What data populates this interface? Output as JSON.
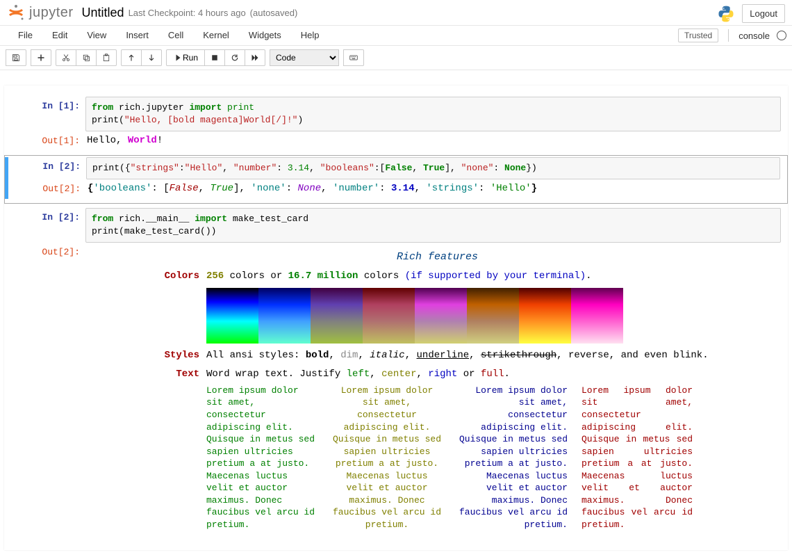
{
  "header": {
    "logo_text": "jupyter",
    "title": "Untitled",
    "checkpoint": "Last Checkpoint: 4 hours ago",
    "autosave": "(autosaved)",
    "logout": "Logout"
  },
  "menu": {
    "file": "File",
    "edit": "Edit",
    "view": "View",
    "insert": "Insert",
    "cell": "Cell",
    "kernel": "Kernel",
    "widgets": "Widgets",
    "help": "Help",
    "trusted": "Trusted",
    "console": "console"
  },
  "toolbar": {
    "run": "Run",
    "celltype": "Code"
  },
  "cells": [
    {
      "in_prompt": "In [1]:",
      "out_prompt": "Out[1]:",
      "code": {
        "l1": {
          "kw_from": "from",
          "mod": " rich.jupyter ",
          "kw_import": "import",
          "what": " print"
        },
        "l2": {
          "fn": "print",
          "paren_open": "(",
          "str": "\"Hello, [bold magenta]World[/]!\"",
          "paren_close": ")"
        }
      },
      "out": {
        "hello": "Hello, ",
        "world": "World",
        "bang": "!"
      }
    },
    {
      "in_prompt": "In [2]:",
      "out_prompt": "Out[2]:",
      "code": {
        "fn": "print",
        "paren_open": "({",
        "k_strings": "\"strings\"",
        "c1": ":",
        "v_strings": "\"Hello\"",
        "comma1": ", ",
        "k_number": "\"number\"",
        "c2": ": ",
        "v_number": "3.14",
        "comma2": ", ",
        "k_bool": "\"booleans\"",
        "c3": ":[",
        "v_false": "False",
        "comma3": ", ",
        "v_true": "True",
        "close_b": "], ",
        "k_none": "\"none\"",
        "c4": ": ",
        "v_none": "None",
        "paren_close": "})"
      },
      "out": {
        "open": "{",
        "k1": "'booleans'",
        "c1": ": [",
        "v_false": "False",
        "comma": ", ",
        "v_true": "True",
        "close1": "], ",
        "k2": "'none'",
        "c2": ": ",
        "v_none": "None",
        "comma2": ", ",
        "k3": "'number'",
        "c3": ": ",
        "v_num": "3.14",
        "comma3": ", ",
        "k4": "'strings'",
        "c4": ": ",
        "v_str": "'Hello'",
        "close": "}"
      }
    },
    {
      "in_prompt": "In [2]:",
      "out_prompt": "Out[2]:",
      "code": {
        "l1": {
          "kw_from": "from",
          "mod": " rich.__main__ ",
          "kw_import": "import",
          "what": " make_test_card"
        },
        "l2": {
          "fn": "print",
          "body": "(make_test_card())"
        }
      },
      "features": {
        "title": "Rich features",
        "colors": {
          "label": "Colors",
          "n256": "256",
          "mid": " colors or ",
          "m167": "16.7 million",
          "rest": " colors ",
          "paren": "(if supported by your terminal)",
          "dot": "."
        },
        "styles": {
          "label": "Styles",
          "pre": "All ansi styles: ",
          "bold": "bold",
          "c1": ", ",
          "dim": "dim",
          "c2": ", ",
          "italic": "italic",
          "c3": ", ",
          "underline": "underline",
          "c4": ", ",
          "strike": "strikethrough",
          "c5": ", reverse, and even blink."
        },
        "text": {
          "label": "Text",
          "pre": "Word wrap text. Justify ",
          "left": "left",
          "c1": ", ",
          "center": "center",
          "c2": ", ",
          "right": "right",
          "or": " or ",
          "full": "full",
          "dot": "."
        },
        "lorem": "Lorem ipsum dolor sit amet, consectetur adipiscing elit. Quisque in metus sed sapien ultricies pretium a at justo. Maecenas luctus velit et auctor maximus. Donec faucibus vel arcu id pretium."
      }
    }
  ]
}
